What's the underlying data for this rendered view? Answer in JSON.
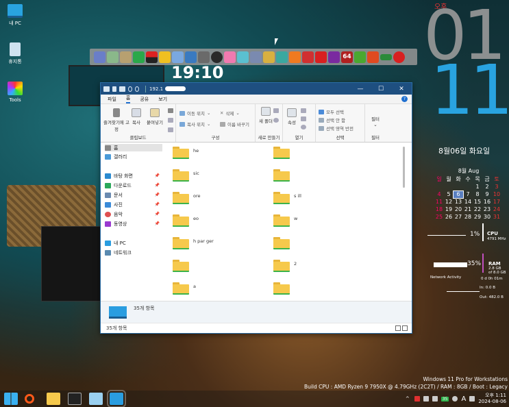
{
  "desktop": {
    "icons": [
      {
        "label": "내 PC",
        "icon": "computer-icon"
      },
      {
        "label": "휴지통",
        "icon": "recycle-bin-icon"
      },
      {
        "label": "Tools",
        "icon": "tools-icon"
      }
    ],
    "monitor_text": "19:10"
  },
  "dock": {
    "icons": [
      "app-icon-1",
      "app-icon-2",
      "app-icon-3",
      "plus-icon",
      "battery-icon",
      "warning-icon",
      "grid-icon",
      "network-icon",
      "settings-icon",
      "s-icon",
      "window-icon",
      "bin-icon",
      "bird-icon",
      "brush-icon",
      "swirl-icon",
      "g-icon",
      "equalizer-icon",
      "lightning-icon",
      "cpu-icon",
      "64-icon",
      "utorrent-icon",
      "shield-icon",
      "ram-icon",
      "power-icon"
    ],
    "label_64": "64"
  },
  "clock": {
    "ampm": "오후",
    "hour": "01",
    "minute": "11",
    "date": "8월06일 화요일"
  },
  "calendar": {
    "month": "8월 Aug",
    "weekdays": [
      "일",
      "월",
      "화",
      "수",
      "목",
      "금",
      "토"
    ],
    "weeks": [
      [
        "",
        "",
        "",
        "",
        "1",
        "2",
        "3"
      ],
      [
        "4",
        "5",
        "6",
        "7",
        "8",
        "9",
        "10"
      ],
      [
        "11",
        "12",
        "13",
        "14",
        "15",
        "16",
        "17"
      ],
      [
        "18",
        "19",
        "20",
        "21",
        "22",
        "23",
        "24"
      ],
      [
        "25",
        "26",
        "27",
        "28",
        "29",
        "30",
        "31"
      ]
    ],
    "today": "6"
  },
  "monitors": {
    "cpu_pct": "1%",
    "cpu_label": "CPU",
    "cpu_mhz": "4791 MHz",
    "ram_pct": "35%",
    "ram_label": "RAM",
    "ram_used": "2.8 GB",
    "ram_total": "of 8.0 GB",
    "ram_fraction": 0.35,
    "network_label": "Network Activity",
    "uptime": "0 d 0h 01m",
    "net_in": "In: 0.0 B",
    "net_out": "Out: 482.0 B"
  },
  "explorer": {
    "path": "192.1",
    "tabs": [
      "파일",
      "홈",
      "공유",
      "보기"
    ],
    "active_tab": "홈",
    "ribbon": {
      "pin": "즐겨찾기에 고정",
      "copy": "복사",
      "paste": "붙여넣기",
      "clipboard_group": "클립보드",
      "move_to": "이동 위치",
      "copy_to": "복사 위치",
      "delete": "삭제",
      "rename": "이름 바꾸기",
      "organize_group": "구성",
      "new_folder": "새 폴더",
      "new_group": "새로 만들기",
      "properties": "속성",
      "open_group": "열기",
      "select_all": "모두 선택",
      "select_none": "선택 안 함",
      "invert_selection": "선택 영역 반전",
      "select_group": "선택",
      "filter": "필터",
      "filter_group": "필터"
    },
    "nav": {
      "home": "홈",
      "gallery": "갤러리",
      "desktop": "바탕 화면",
      "downloads": "다운로드",
      "documents": "문서",
      "pictures": "사진",
      "music": "음악",
      "videos": "동영상",
      "this_pc": "내 PC",
      "network": "네트워크"
    },
    "files_left": [
      "he",
      "sic",
      "ore",
      "eo",
      "h par ger",
      "",
      "a"
    ],
    "files_right": [
      "",
      "",
      "s ill",
      "w",
      "",
      "2",
      ""
    ],
    "detail_count": "35개 항목",
    "status_count": "35개 항목"
  },
  "system": {
    "os": "Windows 11 Pro for Workstations",
    "build": "Build CPU : AMD Ryzen 9 7950X @ 4.79GHz (2C2T) / RAM : 8GB / Boot : Legacy"
  },
  "taskbar": {
    "apps": [
      "windows-start-icon",
      "search-icon",
      "file-explorer-icon",
      "terminal-icon",
      "notepad-icon",
      "monitor-app-icon"
    ],
    "tray_badge": "35",
    "tray_lang": "A",
    "time": "오후 1:11",
    "date": "2024-08-06"
  },
  "colors": {
    "accent": "#29a3e0",
    "titlebar": "#1e4f80",
    "folder": "#f6c94c"
  }
}
